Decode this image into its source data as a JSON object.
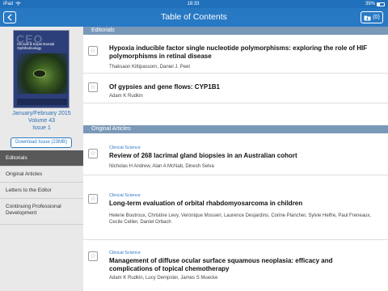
{
  "statusbar": {
    "carrier": "iPad",
    "time": "18:33",
    "battery": "39%"
  },
  "navbar": {
    "title": "Table of Contents",
    "cart_count": "(0)"
  },
  "sidebar": {
    "issue_date": "January/February 2015",
    "volume": "Volume 43",
    "issue": "Issue 1",
    "download_label": "Download Issue (23MB)",
    "cover_title": "Clinical & Experimental Ophthalmology",
    "items": [
      {
        "label": "Editorials",
        "active": true
      },
      {
        "label": "Original Articles",
        "active": false
      },
      {
        "label": "Letters to the Editor",
        "active": false
      },
      {
        "label": "Continuing Professional Development",
        "active": false
      }
    ]
  },
  "sections": [
    {
      "header": "Editorials",
      "articles": [
        {
          "category": "",
          "title": "Hypoxia inducible factor single nucleotide polymorphisms: exploring the role of HIF polymorphisms in retinal disease",
          "authors": "Thaksaon Kittipassorn, Daniel J. Peet"
        },
        {
          "category": "",
          "title": "Of gypsies and gene flows: CYP1B1",
          "authors": "Adam K Rudkin"
        }
      ]
    },
    {
      "header": "Original Articles",
      "articles": [
        {
          "category": "Clinical Science",
          "title": "Review of 268 lacrimal gland biopsies in an Australian cohort",
          "authors": "Nicholas H Andrew, Alan A McNab, Dinesh Selva"
        },
        {
          "category": "Clinical Science",
          "title": "Long-term evaluation of orbital rhabdomyosarcoma in children",
          "authors": "Helene Boutroux, Christine Levy, Veronique Mosseri, Laurence Desjardins, Corine Plancher, Sylvie Helfre, Paul Freneaux, Cecile Cellier, Daniel Orbach"
        },
        {
          "category": "Clinical Science",
          "title": "Management of diffuse ocular surface squamous neoplasia: efficacy and complications of topical chemotherapy",
          "authors": "Adam K Rudkin, Lucy Dempster, James S Muecke"
        }
      ]
    }
  ],
  "colors": {
    "navbar": "#2879c4",
    "section_header": "#7a98b8",
    "link": "#2a79c6"
  }
}
